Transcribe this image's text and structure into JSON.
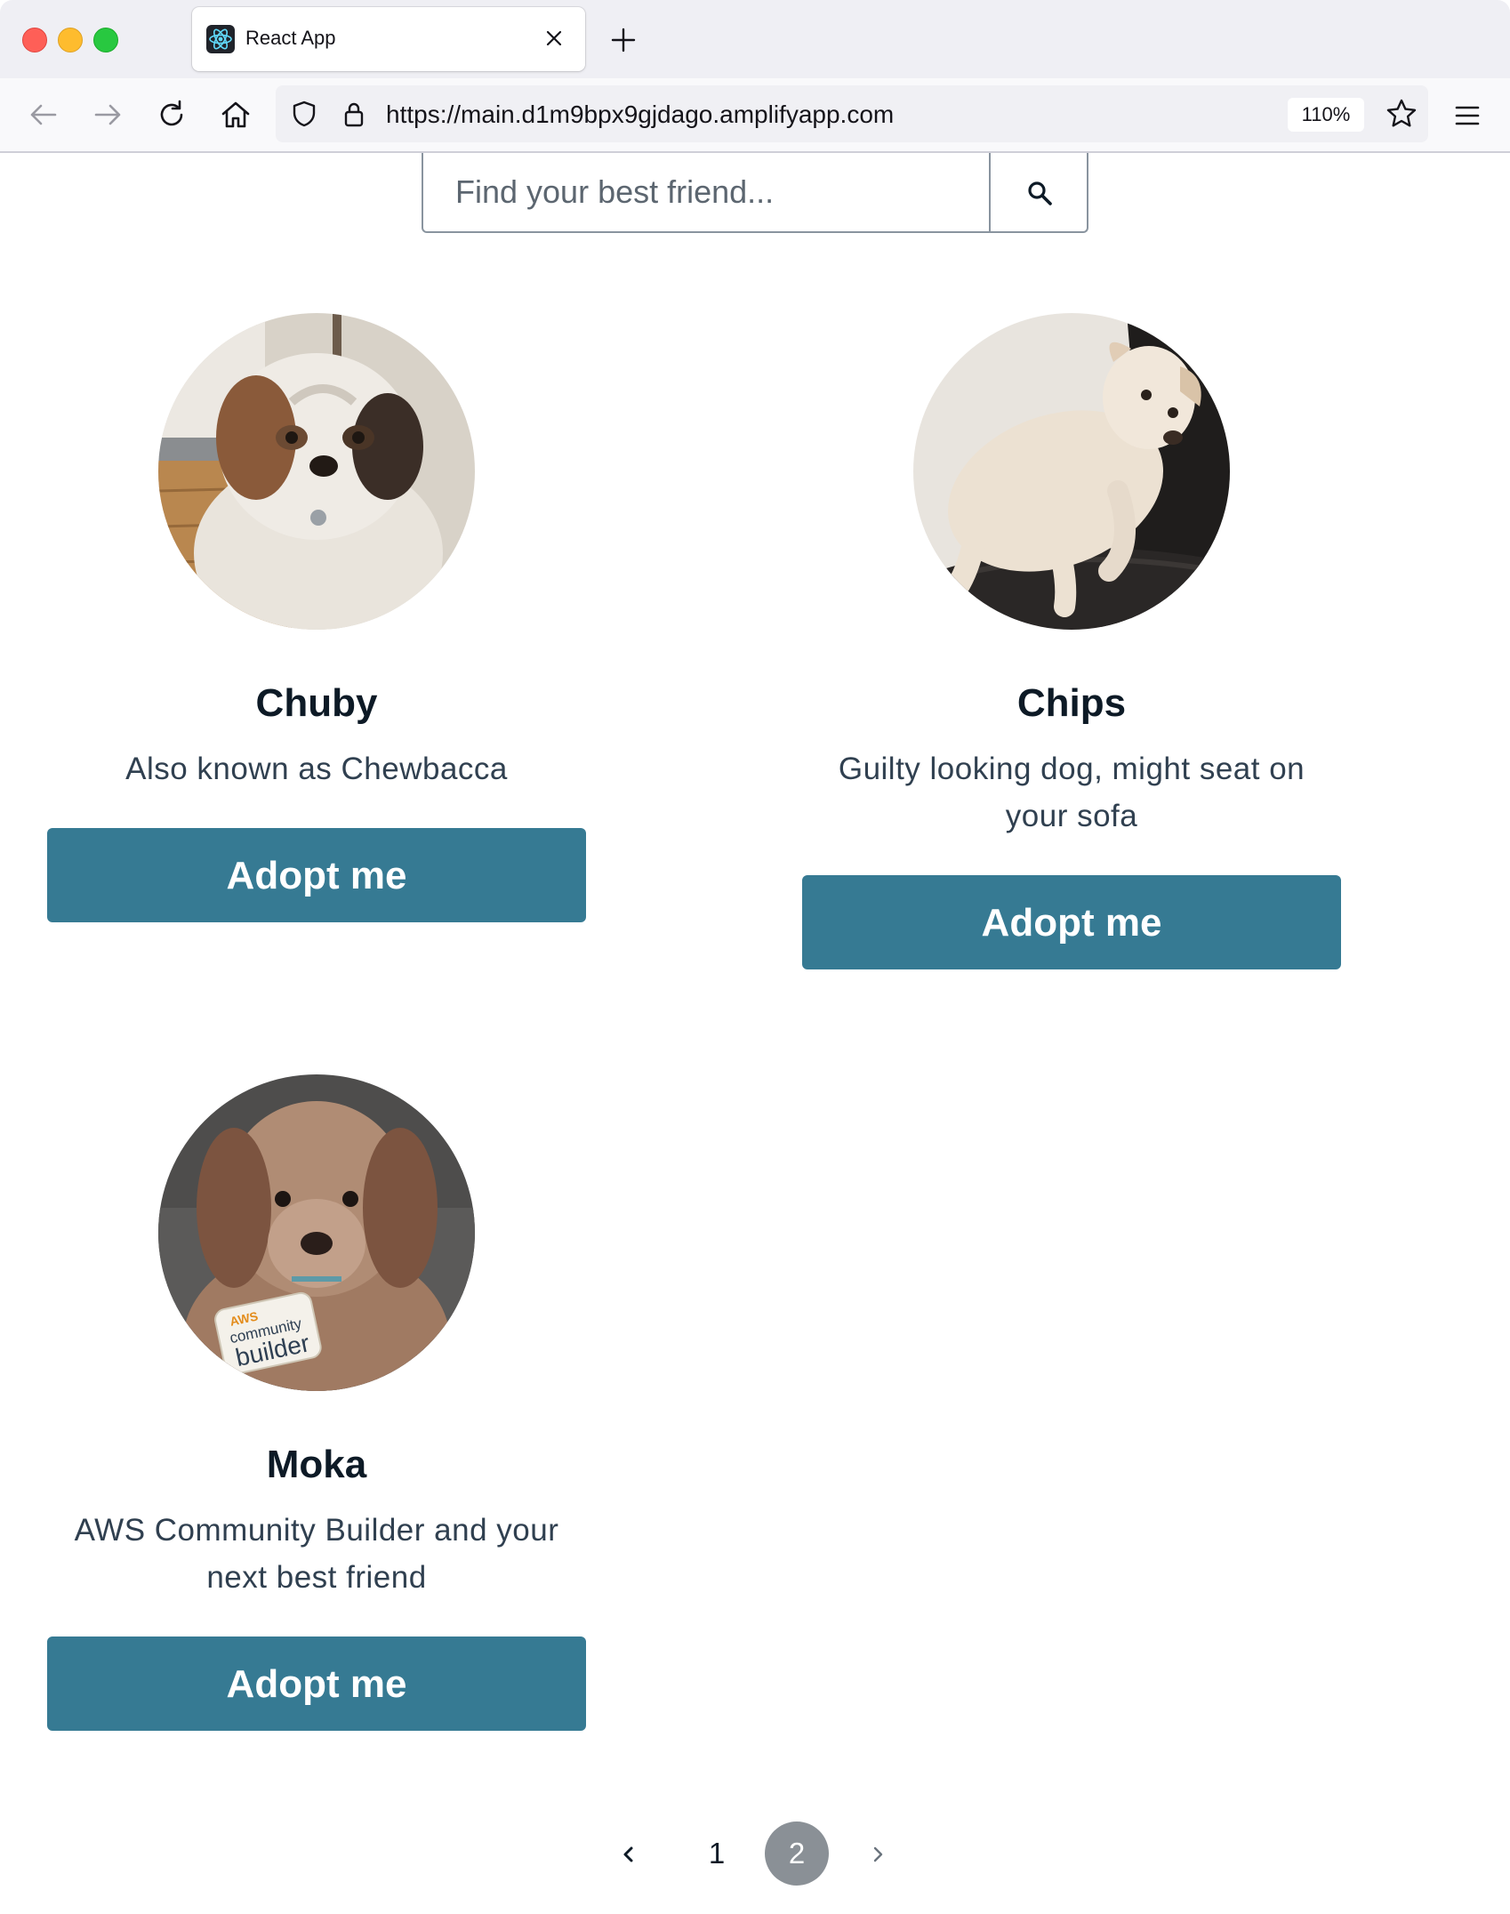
{
  "browser": {
    "tab_title": "React App",
    "url": "https://main.d1m9bpx9gjdago.amplifyapp.com",
    "zoom": "110%",
    "icons": [
      "react-favicon-icon",
      "close-icon",
      "plus-icon",
      "back-arrow-icon",
      "forward-arrow-icon",
      "reload-icon",
      "home-icon",
      "shield-icon",
      "lock-icon",
      "star-icon",
      "hamburger-menu-icon"
    ]
  },
  "search": {
    "placeholder": "Find your best friend...",
    "value": "",
    "icon": "search-icon"
  },
  "pets": [
    {
      "name": "Chuby",
      "description": "Also known as Chewbacca",
      "button": "Adopt me",
      "photo": "shaggy white and brown small dog"
    },
    {
      "name": "Chips",
      "description": "Guilty looking dog, might seat on your sofa",
      "button": "Adopt me",
      "photo": "cream colored puppy lying on a black sofa"
    },
    {
      "name": "Moka",
      "description": "AWS Community Builder and your next best friend",
      "button": "Adopt me",
      "photo": "fluffy brown dog with community builder sticker",
      "sticker_text": {
        "top": "AWS",
        "middle": "community",
        "bottom": "builder"
      }
    }
  ],
  "pagination": {
    "pages": [
      "1",
      "2"
    ],
    "current": "2",
    "prev_icon": "chevron-left-icon",
    "next_icon": "chevron-right-icon"
  },
  "colors": {
    "button": "#367a93",
    "current_page": "#8a9096",
    "text_dark": "#0d1a26",
    "text_body": "#304050"
  }
}
